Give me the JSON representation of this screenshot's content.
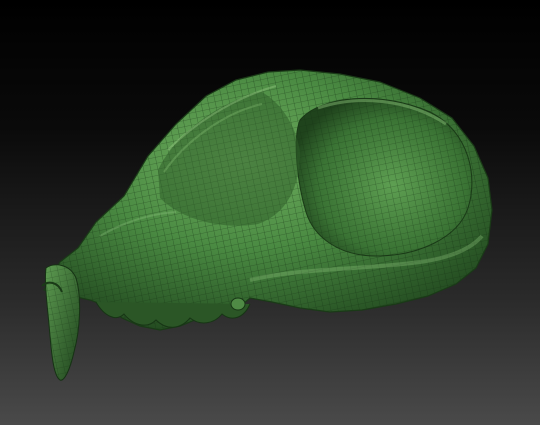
{
  "scene": {
    "subject_icon": "skull-mesh-icon",
    "colors": {
      "background_top": "#000000",
      "background_bottom": "#4a4a4a",
      "mesh_base": "#3f7a3a",
      "mesh_highlight": "#6fae5f",
      "mesh_shadow": "#1d3f1b",
      "wireframe": "#143012"
    }
  }
}
